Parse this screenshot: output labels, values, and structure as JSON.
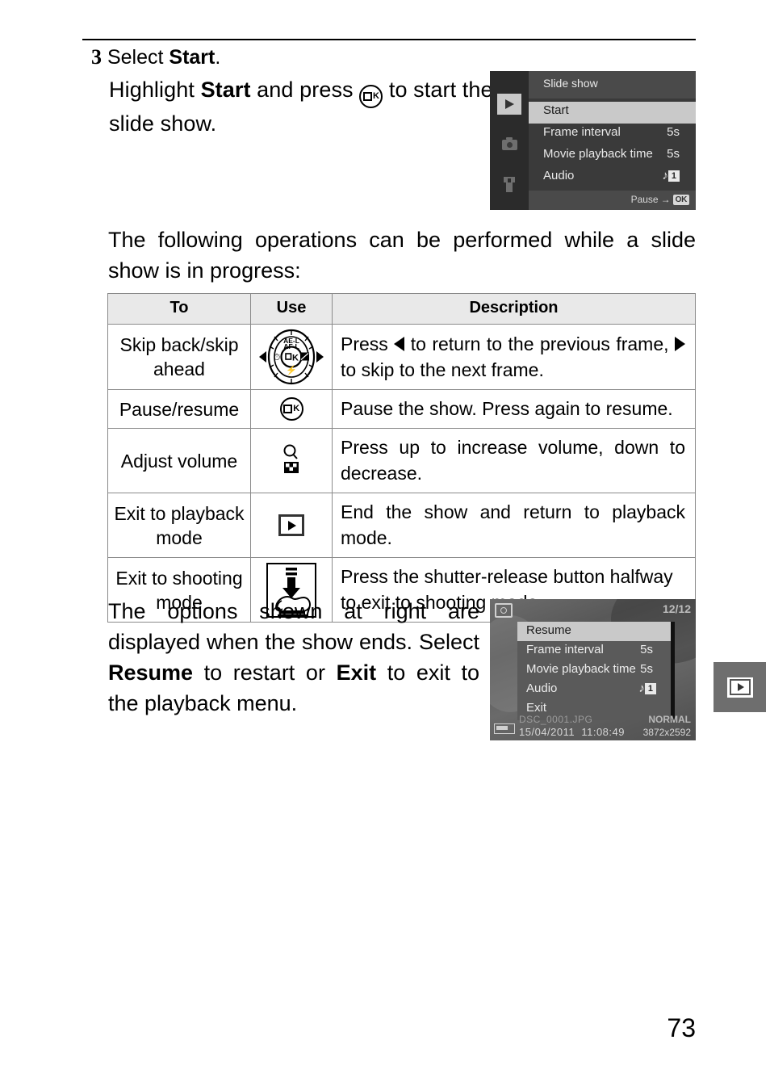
{
  "page": {
    "number": "73"
  },
  "step": {
    "number": "3",
    "title_prefix": "Select ",
    "title_bold": "Start",
    "title_suffix": ".",
    "body_1": "Highlight ",
    "body_bold": "Start",
    "body_2": " and press ",
    "icon": "ok-button-icon",
    "body_3": " to start the slide show."
  },
  "menu_screenshot_top": {
    "title": "Slide show",
    "tabs": [
      {
        "name": "playback-tab-icon",
        "selected": true
      },
      {
        "name": "shooting-tab-icon",
        "selected": false
      },
      {
        "name": "setup-tab-icon",
        "selected": false
      }
    ],
    "rows": [
      {
        "label": "Start",
        "value": "",
        "highlighted": true
      },
      {
        "label": "Frame interval",
        "value": "5s",
        "highlighted": false
      },
      {
        "label": "Movie playback time",
        "value": "5s",
        "highlighted": false
      },
      {
        "label": "Audio",
        "value": "1",
        "value_icon": "music-note-icon",
        "highlighted": false
      }
    ],
    "footer_label": "Pause",
    "footer_arrow": "→",
    "footer_badge": "OK"
  },
  "paragraph_operations": "The following operations can be performed while a slide show is in progress:",
  "table": {
    "headers": [
      "To",
      "Use",
      "Description"
    ],
    "rows": [
      {
        "to": "Skip back/skip ahead",
        "use_icon": "multi-selector-icon",
        "desc_1": "Press ",
        "desc_left_arrow": "◀",
        "desc_2": " to return to the previous frame, ",
        "desc_right_arrow": "▶",
        "desc_3": " to skip to the next frame."
      },
      {
        "to": "Pause/resume",
        "use_icon": "ok-button-icon",
        "desc": "Pause the show. Press again to resume."
      },
      {
        "to": "Adjust volume",
        "use_icon": "thumbnail-zoom-out-icon",
        "desc": "Press up to increase volume, down to decrease."
      },
      {
        "to": "Exit to playback mode",
        "use_icon": "playback-button-icon",
        "desc": "End the show and return to playback mode."
      },
      {
        "to": "Exit to shooting mode",
        "use_icon": "shutter-release-halfway-icon",
        "desc": "Press the shutter-release button halfway to exit to shooting mode."
      }
    ]
  },
  "paragraph_options": {
    "text_1": "The options shown at right are displayed when the show ends. Select ",
    "bold_1": "Resume",
    "text_2": " to restart or ",
    "bold_2": "Exit",
    "text_3": " to exit to the playback menu."
  },
  "menu_screenshot_bottom": {
    "frame_counter": "12/12",
    "rows": [
      {
        "label": "Resume",
        "value": "",
        "highlighted": true
      },
      {
        "label": "Frame interval",
        "value": "5s",
        "highlighted": false
      },
      {
        "label": "Movie playback time",
        "value": "5s",
        "highlighted": false
      },
      {
        "label": "Audio",
        "value": "1",
        "value_icon": "music-note-icon",
        "highlighted": false
      },
      {
        "label": "Exit",
        "value": "",
        "highlighted": false
      }
    ],
    "filename": "DSC_0001.JPG",
    "date": "15/04/2011",
    "time": "11:08:49",
    "quality": "NORMAL",
    "dimensions": "3872x2592"
  },
  "margin_tab": {
    "icon": "playback-menu-icon"
  },
  "colors": {
    "header_fill": "#e9e9e9",
    "rule": "#000000",
    "lcd_bg": "#3a3a3a",
    "lcd_highlight": "#c9c9c9",
    "margin_tab": "#6e6e6e"
  }
}
